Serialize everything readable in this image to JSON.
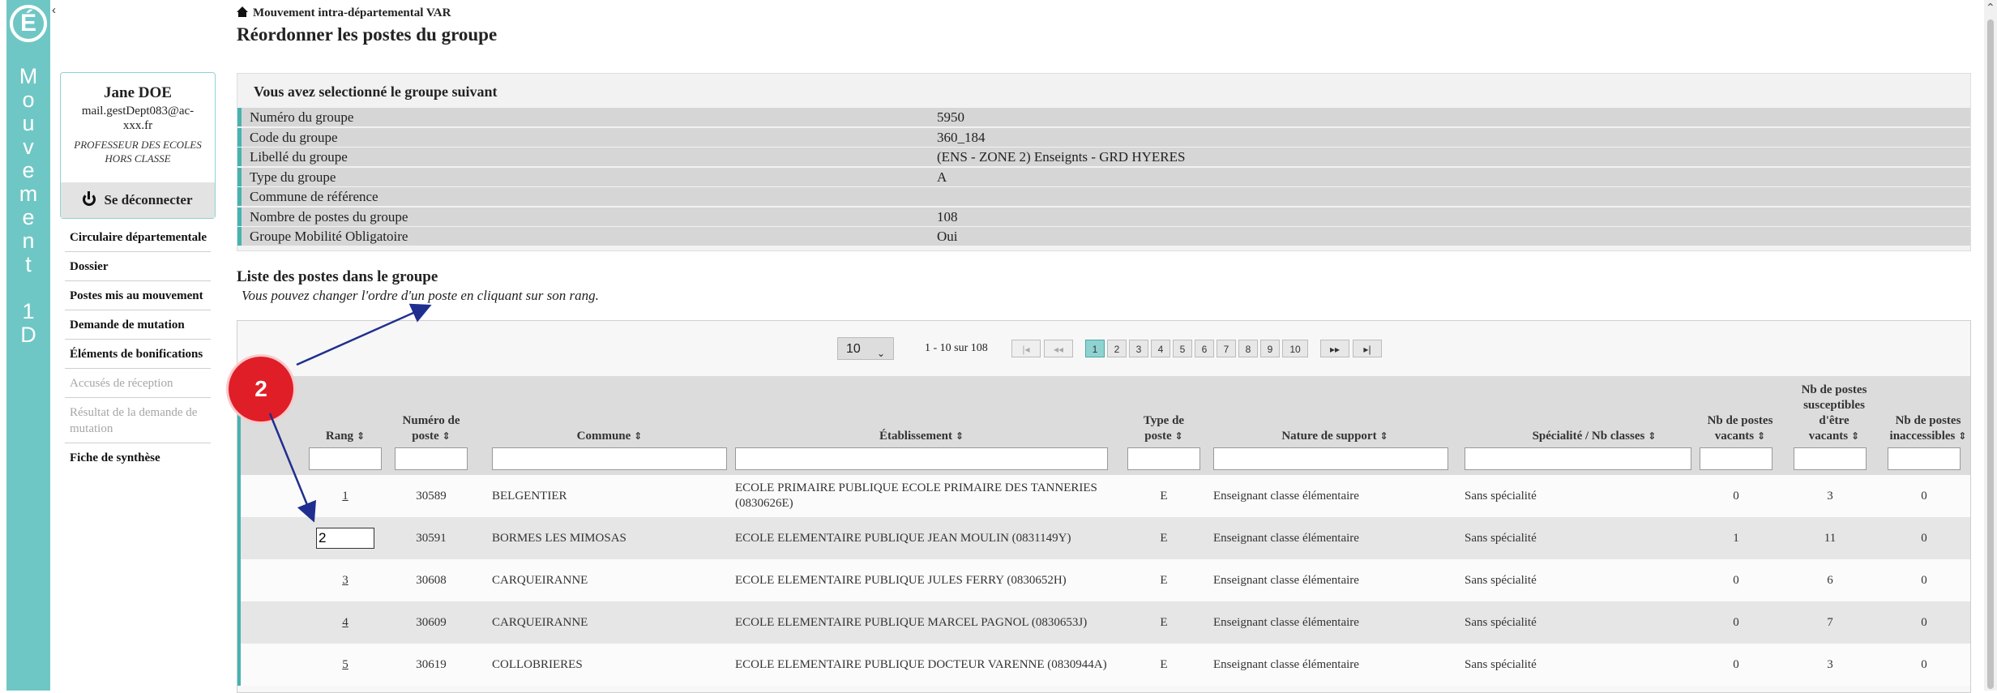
{
  "brand": {
    "logo_letter": "É",
    "vertical_letters": [
      "M",
      "o",
      "u",
      "v",
      "e",
      "m",
      "e",
      "n",
      "t",
      "",
      "1",
      "D"
    ],
    "collapse_glyph": "‹"
  },
  "user": {
    "name": "Jane DOE",
    "email": "mail.gestDept083@ac-xxx.fr",
    "role": "PROFESSEUR DES ECOLES HORS CLASSE",
    "logout_label": "Se déconnecter"
  },
  "nav": [
    {
      "label": "Circulaire départementale",
      "enabled": true
    },
    {
      "label": "Dossier",
      "enabled": true
    },
    {
      "label": "Postes mis au mouvement",
      "enabled": true
    },
    {
      "label": "Demande de mutation",
      "enabled": true
    },
    {
      "label": "Éléments de bonifications",
      "enabled": true
    },
    {
      "label": "Accusés de réception",
      "enabled": false
    },
    {
      "label": "Résultat de la demande de mutation",
      "enabled": false
    },
    {
      "label": "Fiche de synthèse",
      "enabled": true
    }
  ],
  "header": {
    "breadcrumb": "Mouvement intra-départemental VAR",
    "title": "Réordonner les postes du groupe"
  },
  "group_info": {
    "heading": "Vous avez selectionné le groupe suivant",
    "rows": [
      {
        "label": "Numéro du groupe",
        "value": "5950"
      },
      {
        "label": "Code du groupe",
        "value": "360_184"
      },
      {
        "label": "Libellé du groupe",
        "value": "(ENS - ZONE 2) Enseignts - GRD HYERES"
      },
      {
        "label": "Type du groupe",
        "value": "A"
      },
      {
        "label": "Commune de référence",
        "value": ""
      },
      {
        "label": "Nombre de postes du groupe",
        "value": "108"
      },
      {
        "label": "Groupe Mobilité Obligatoire",
        "value": "Oui"
      }
    ]
  },
  "list": {
    "title": "Liste des postes dans le groupe",
    "hint": "Vous pouvez changer l'ordre d'un poste en cliquant sur son rang."
  },
  "pagination": {
    "page_size": "10",
    "range_text": "1 - 10 sur 108",
    "first": "|◂",
    "prev": "◂◂",
    "next": "▸▸",
    "last": "▸|",
    "pages": [
      "1",
      "2",
      "3",
      "4",
      "5",
      "6",
      "7",
      "8",
      "9",
      "10"
    ],
    "current_page": "1"
  },
  "table": {
    "columns": [
      {
        "label": "Rang"
      },
      {
        "label": "Numéro de poste"
      },
      {
        "label": "Commune"
      },
      {
        "label": "Établissement"
      },
      {
        "label": "Type de poste"
      },
      {
        "label": "Nature de support"
      },
      {
        "label": "Spécialité / Nb classes"
      },
      {
        "label": "Nb de postes vacants"
      },
      {
        "label": "Nb de postes susceptibles d'être vacants"
      },
      {
        "label": "Nb de postes inaccessibles"
      }
    ],
    "sort_glyph": "⇕",
    "rows": [
      {
        "rang": "1",
        "poste": "30589",
        "commune": "BELGENTIER",
        "etab": "ECOLE PRIMAIRE PUBLIQUE ECOLE PRIMAIRE DES TANNERIES (0830626E)",
        "type": "E",
        "nature": "Enseignant classe élémentaire",
        "specialite": "Sans spécialité",
        "vacants": "0",
        "susceptibles": "3",
        "inaccessibles": "0",
        "editing": false
      },
      {
        "rang": "2",
        "poste": "30591",
        "commune": "BORMES LES MIMOSAS",
        "etab": "ECOLE ELEMENTAIRE PUBLIQUE JEAN MOULIN (0831149Y)",
        "type": "E",
        "nature": "Enseignant classe élémentaire",
        "specialite": "Sans spécialité",
        "vacants": "1",
        "susceptibles": "11",
        "inaccessibles": "0",
        "editing": true
      },
      {
        "rang": "3",
        "poste": "30608",
        "commune": "CARQUEIRANNE",
        "etab": "ECOLE ELEMENTAIRE PUBLIQUE JULES FERRY (0830652H)",
        "type": "E",
        "nature": "Enseignant classe élémentaire",
        "specialite": "Sans spécialité",
        "vacants": "0",
        "susceptibles": "6",
        "inaccessibles": "0",
        "editing": false
      },
      {
        "rang": "4",
        "poste": "30609",
        "commune": "CARQUEIRANNE",
        "etab": "ECOLE ELEMENTAIRE PUBLIQUE MARCEL PAGNOL (0830653J)",
        "type": "E",
        "nature": "Enseignant classe élémentaire",
        "specialite": "Sans spécialité",
        "vacants": "0",
        "susceptibles": "7",
        "inaccessibles": "0",
        "editing": false
      },
      {
        "rang": "5",
        "poste": "30619",
        "commune": "COLLOBRIERES",
        "etab": "ECOLE ELEMENTAIRE PUBLIQUE DOCTEUR VARENNE (0830944A)",
        "type": "E",
        "nature": "Enseignant classe élémentaire",
        "specialite": "Sans spécialité",
        "vacants": "0",
        "susceptibles": "3",
        "inaccessibles": "0",
        "editing": false
      }
    ]
  },
  "annotation": {
    "label": "2"
  },
  "colors": {
    "brand": "#6fc7c5",
    "accent_border": "#46b3b0",
    "annotation": "#e01e27",
    "arrow": "#1f2f8f"
  }
}
